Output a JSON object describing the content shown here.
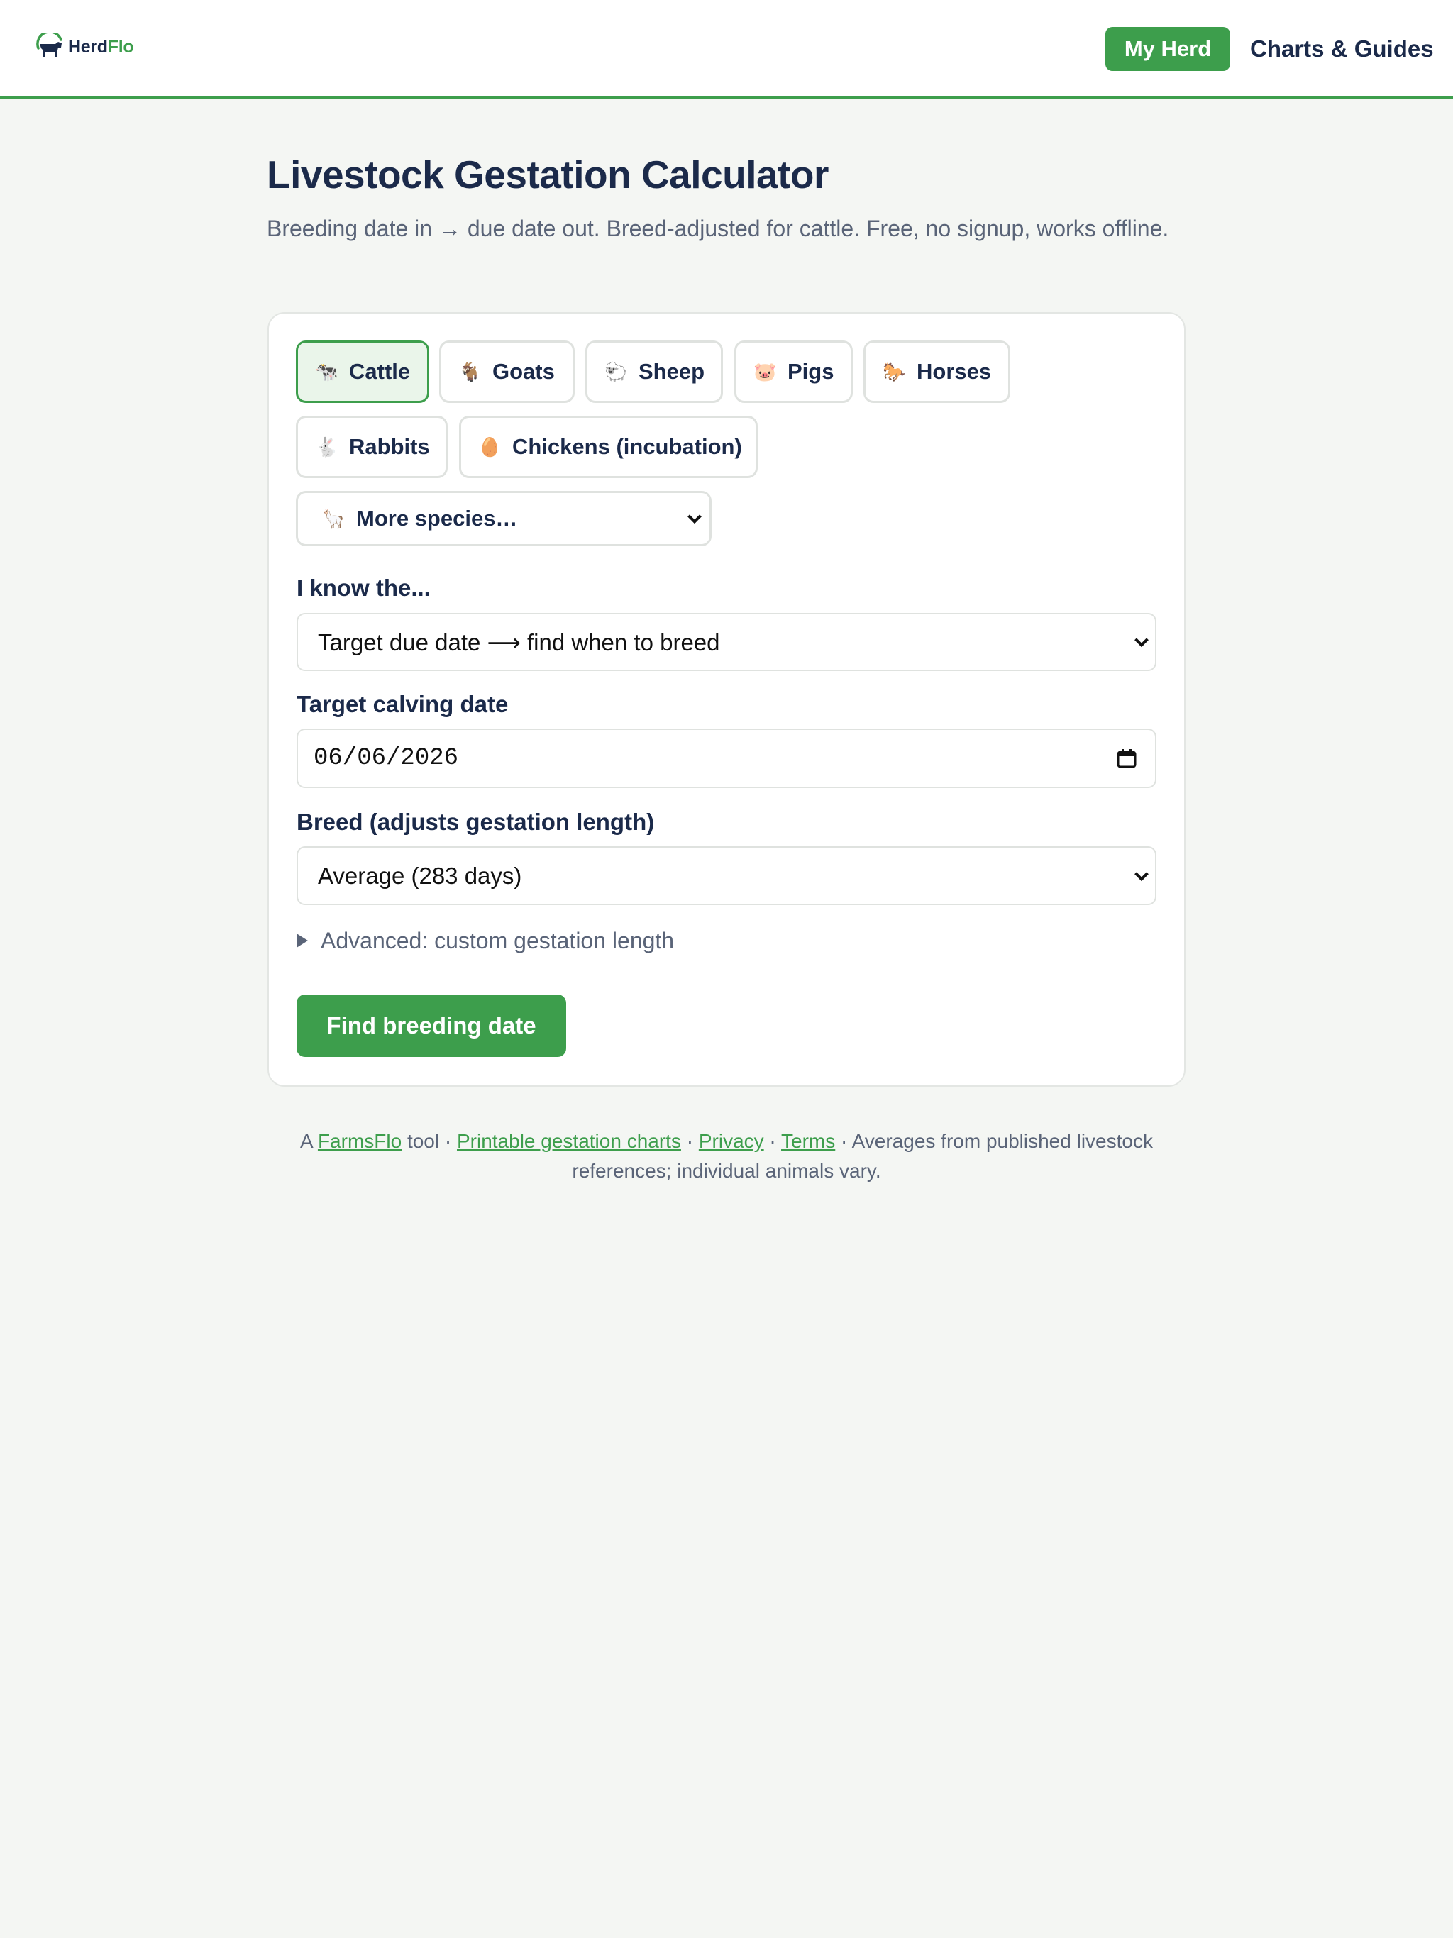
{
  "header": {
    "logo_part1": "Herd",
    "logo_part2": "Flo",
    "nav_my_herd": "My Herd",
    "nav_charts": "Charts & Guides",
    "accent_color": "#3d9e4c"
  },
  "main": {
    "title": "Livestock Gestation Calculator",
    "subtitle": "Breeding date in → due date out. Breed-adjusted for cattle. Free, no signup, works offline."
  },
  "species": [
    {
      "icon": "🐄",
      "icon_name": "cow-icon",
      "label": "Cattle",
      "active": true
    },
    {
      "icon": "🐐",
      "icon_name": "goat-icon",
      "label": "Goats",
      "active": false
    },
    {
      "icon": "🐑",
      "icon_name": "sheep-icon",
      "label": "Sheep",
      "active": false
    },
    {
      "icon": "🐷",
      "icon_name": "pig-icon",
      "label": "Pigs",
      "active": false
    },
    {
      "icon": "🐎",
      "icon_name": "horse-icon",
      "label": "Horses",
      "active": false
    },
    {
      "icon": "🐇",
      "icon_name": "rabbit-icon",
      "label": "Rabbits",
      "active": false
    },
    {
      "icon": "🥚",
      "icon_name": "egg-icon",
      "label": "Chickens (incubation)",
      "active": false
    }
  ],
  "more_species": {
    "icon": "🦙",
    "label": "More species…"
  },
  "form": {
    "mode_label": "I know the...",
    "mode_value": "Target due date ⟶ find when to breed",
    "date_label": "Target calving date",
    "date_value": "06/06/2026",
    "breed_label": "Breed (adjusts gestation length)",
    "breed_value": "Average (283 days)",
    "advanced_label": "Advanced: custom gestation length",
    "submit_label": "Find breeding date"
  },
  "footer": {
    "prefix": "A ",
    "link1": "FarmsFlo",
    "text1": " tool · ",
    "link2": "Printable gestation charts",
    "sep1": " · ",
    "link3": "Privacy",
    "sep2": " · ",
    "link4": "Terms",
    "text2": " · Averages from published livestock references; individual animals vary."
  }
}
